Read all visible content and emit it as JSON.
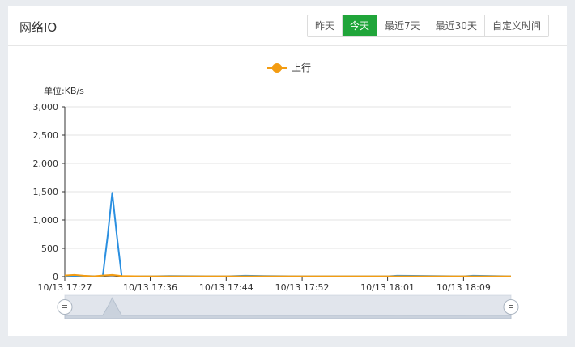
{
  "panel": {
    "title": "网络IO",
    "ranges": [
      {
        "label": "昨天",
        "active": false
      },
      {
        "label": "今天",
        "active": true
      },
      {
        "label": "最近7天",
        "active": false
      },
      {
        "label": "最近30天",
        "active": false
      },
      {
        "label": "自定义时间",
        "active": false
      }
    ]
  },
  "colors": {
    "accent": "#20a53a",
    "upload": "#f39c12",
    "download": "#2a8fe0"
  },
  "chart_data": {
    "type": "line",
    "unit_label": "单位:KB/s",
    "legend": [
      {
        "name": "上行",
        "color": "#f39c12"
      }
    ],
    "legend_position": "top-center",
    "grid": true,
    "ylim": [
      0,
      3000
    ],
    "y_ticks": [
      "3,000",
      "2,500",
      "2,000",
      "1,500",
      "1,000",
      "500",
      "0"
    ],
    "x_ticks": [
      "10/13 17:27",
      "10/13 17:36",
      "10/13 17:44",
      "10/13 17:52",
      "10/13 18:01",
      "10/13 18:09"
    ],
    "series": [
      {
        "name": "上行",
        "color": "#f39c12",
        "x": [
          "10/13 17:27",
          "10/13 17:28",
          "10/13 17:29",
          "10/13 17:30",
          "10/13 17:31",
          "10/13 17:32",
          "10/13 17:33",
          "10/13 17:35",
          "10/13 17:44",
          "10/13 17:52",
          "10/13 18:01",
          "10/13 18:09",
          "10/13 18:14"
        ],
        "values": [
          20,
          30,
          15,
          5,
          20,
          30,
          10,
          5,
          5,
          5,
          5,
          5,
          5
        ]
      },
      {
        "color": "#2a8fe0",
        "x": [
          "10/13 17:27",
          "10/13 17:29",
          "10/13 17:31",
          "10/13 17:31:30",
          "10/13 17:32",
          "10/13 17:32:30",
          "10/13 17:33",
          "10/13 17:36",
          "10/13 17:38",
          "10/13 17:44",
          "10/13 17:46",
          "10/13 17:48",
          "10/13 17:52",
          "10/13 18:01",
          "10/13 18:02",
          "10/13 18:09",
          "10/13 18:10",
          "10/13 18:14"
        ],
        "values": [
          5,
          10,
          5,
          700,
          1480,
          700,
          5,
          5,
          10,
          5,
          15,
          10,
          5,
          5,
          15,
          5,
          15,
          5
        ]
      }
    ]
  }
}
